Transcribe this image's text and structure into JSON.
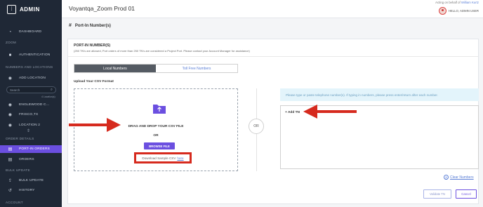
{
  "colors": {
    "sidebar_bg": "#1f2836",
    "accent": "#6b4fe0",
    "link": "#5b7fd6",
    "annotation_red": "#d62a1e"
  },
  "sidebar": {
    "brand": "ADMIN",
    "sections": {
      "zoom": "ZOOM",
      "numbers_locations": "NUMBERS AND LOCATIONS",
      "order_details": "ORDER DETAILS",
      "bulk_update": "BULK UPDATE",
      "account": "ACCOUNT"
    },
    "items": {
      "dashboard": "DASHBOARD",
      "authentication": "AUTHENTICATION",
      "add_location": "ADD LOCATION",
      "englewood": "ENGLEWOOD C...",
      "frisco": "FRISCO,TX",
      "location2": "LOCATION 2",
      "port_in_orders": "PORT-IN ORDERS",
      "orders": "ORDERS",
      "bulk_update": "BULK UPDATE",
      "history": "HISTORY"
    },
    "search_placeholder": "Search",
    "location_count": "4 Location(s)"
  },
  "header": {
    "title": "Voyantqa_Zoom Prod 01",
    "acting_prefix": "Acting on behalf of",
    "acting_user": "William Kurtz",
    "hello": "HELLO, ADMIN USER"
  },
  "main": {
    "page_title": "Port-In Number(s)",
    "heading": "PORT-IN NUMBER(S)",
    "subtext": "(250 TN's are allowed, Port orders of more than 250 TN's are considered a Project Port. Please contact your Account Manager for assistance)",
    "tabs": [
      "Local Numbers",
      "Toll Free Numbers"
    ],
    "upload_label": "Upload Your CSV Format",
    "drag_text": "DRAG AND DROP YOUR CSV FILE",
    "or_text": "OR",
    "browse_label": "BROWSE FILE",
    "sample_text": "Download Sample CSV",
    "sample_link": "here",
    "or_divider": "OR",
    "info_text": "Please type or paste telephone number(s). If typing in numbers, please press enter/return after each number.",
    "add_tn_label": "+ Add TN",
    "clear_label": "Clear Numbers",
    "validate_label": "Validate TN",
    "cancel_label": "Cancel"
  }
}
